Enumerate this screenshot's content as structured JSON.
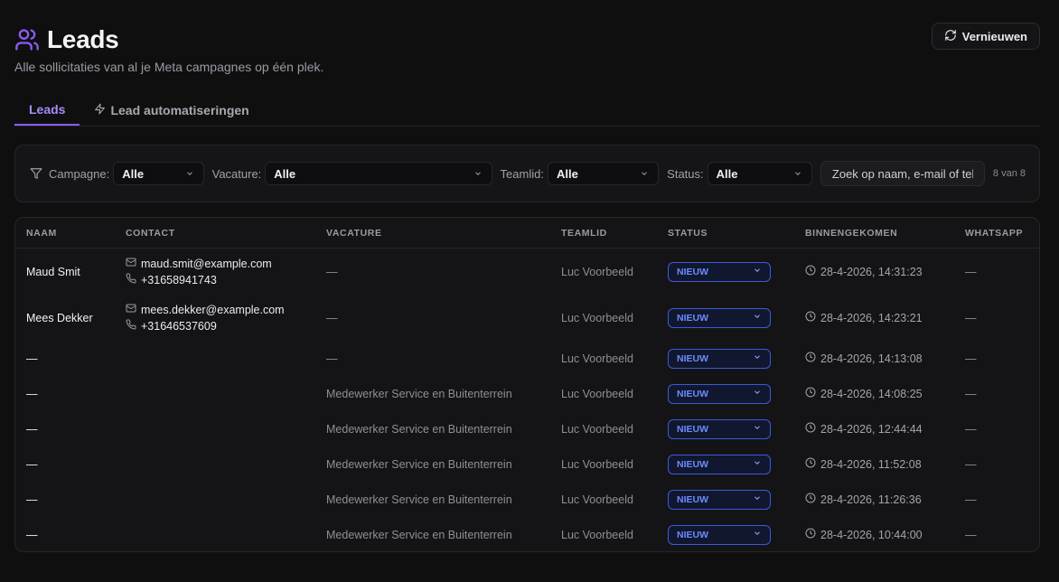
{
  "header": {
    "title": "Leads",
    "subtitle": "Alle sollicitaties van al je Meta campagnes op één plek.",
    "refresh_label": "Vernieuwen",
    "accent": "#8b5cf6"
  },
  "tabs": [
    {
      "label": "Leads",
      "active": true
    },
    {
      "label": "Lead automatiseringen",
      "active": false,
      "icon": "lightning-icon"
    }
  ],
  "filters": {
    "campagne_label": "Campagne:",
    "campagne_value": "Alle",
    "vacature_label": "Vacature:",
    "vacature_value": "Alle",
    "teamlid_label": "Teamlid:",
    "teamlid_value": "Alle",
    "status_label": "Status:",
    "status_value": "Alle",
    "search_placeholder": "Zoek op naam, e-mail of tel",
    "count": "8 van 8"
  },
  "table": {
    "columns": {
      "naam": "NAAM",
      "contact": "CONTACT",
      "vacature": "VACATURE",
      "teamlid": "TEAMLID",
      "status": "STATUS",
      "binnengekomen": "BINNENGEKOMEN",
      "whatsapp": "WHATSAPP"
    },
    "rows": [
      {
        "naam": "Maud Smit",
        "email": "maud.smit@example.com",
        "phone": "+31658941743",
        "vacature": "—",
        "teamlid": "Luc Voorbeeld",
        "status": "NIEUW",
        "date": "28-4-2026, 14:31:23",
        "whatsapp": "—"
      },
      {
        "naam": "Mees Dekker",
        "email": "mees.dekker@example.com",
        "phone": "+31646537609",
        "vacature": "—",
        "teamlid": "Luc Voorbeeld",
        "status": "NIEUW",
        "date": "28-4-2026, 14:23:21",
        "whatsapp": "—"
      },
      {
        "naam": "—",
        "email": "",
        "phone": "",
        "vacature": "—",
        "teamlid": "Luc Voorbeeld",
        "status": "NIEUW",
        "date": "28-4-2026, 14:13:08",
        "whatsapp": "—"
      },
      {
        "naam": "—",
        "email": "",
        "phone": "",
        "vacature": "Medewerker Service en Buitenterrein",
        "teamlid": "Luc Voorbeeld",
        "status": "NIEUW",
        "date": "28-4-2026, 14:08:25",
        "whatsapp": "—"
      },
      {
        "naam": "—",
        "email": "",
        "phone": "",
        "vacature": "Medewerker Service en Buitenterrein",
        "teamlid": "Luc Voorbeeld",
        "status": "NIEUW",
        "date": "28-4-2026, 12:44:44",
        "whatsapp": "—"
      },
      {
        "naam": "—",
        "email": "",
        "phone": "",
        "vacature": "Medewerker Service en Buitenterrein",
        "teamlid": "Luc Voorbeeld",
        "status": "NIEUW",
        "date": "28-4-2026, 11:52:08",
        "whatsapp": "—"
      },
      {
        "naam": "—",
        "email": "",
        "phone": "",
        "vacature": "Medewerker Service en Buitenterrein",
        "teamlid": "Luc Voorbeeld",
        "status": "NIEUW",
        "date": "28-4-2026, 11:26:36",
        "whatsapp": "—"
      },
      {
        "naam": "—",
        "email": "",
        "phone": "",
        "vacature": "Medewerker Service en Buitenterrein",
        "teamlid": "Luc Voorbeeld",
        "status": "NIEUW",
        "date": "28-4-2026, 10:44:00",
        "whatsapp": "—"
      }
    ]
  }
}
